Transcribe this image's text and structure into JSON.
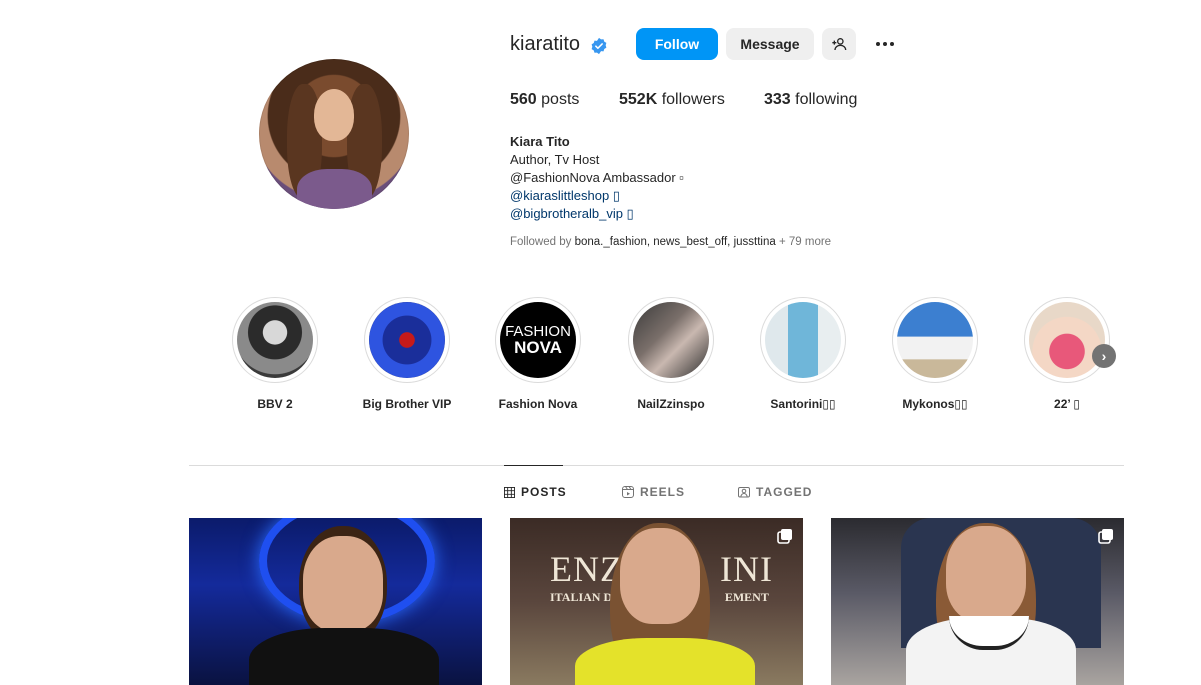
{
  "profile": {
    "username": "kiaratito",
    "verified": true,
    "follow_label": "Follow",
    "message_label": "Message",
    "stats": {
      "posts_count": "560",
      "posts_label": "posts",
      "followers_count": "552K",
      "followers_label": "followers",
      "following_count": "333",
      "following_label": "following"
    },
    "bio": {
      "name": "Kiara Tito",
      "line1": "Author, Tv Host",
      "line2": "@FashionNova Ambassador ▫",
      "link1": "@kiaraslittleshop ▯",
      "link2": "@bigbrotheralb_vip ▯"
    },
    "followed_by": {
      "prefix": "Followed by",
      "names": "bona._fashion, news_best_off, jussttina",
      "more": "+ 79 more"
    }
  },
  "highlights": [
    {
      "label": "BBV 2"
    },
    {
      "label": "Big Brother VIP"
    },
    {
      "label": "Fashion Nova"
    },
    {
      "label": "NailZzinspo"
    },
    {
      "label": "Santorini▯▯"
    },
    {
      "label": "Mykonos▯▯"
    },
    {
      "label": "22’ ▯"
    }
  ],
  "highlight_logo": {
    "top": "FASHION",
    "bottom": "NOVA"
  },
  "tabs": [
    {
      "label": "POSTS",
      "icon": "grid-icon",
      "active": true
    },
    {
      "label": "REELS",
      "icon": "reels-icon",
      "active": false
    },
    {
      "label": "TAGGED",
      "icon": "tagged-icon",
      "active": false
    }
  ],
  "posts": {
    "post2_sign": "ENZO",
    "post2_sign_b": "INI",
    "post2_sub": "ITALIAN DES",
    "post2_sub_b": "EMENT"
  },
  "colors": {
    "accent": "#0095f6",
    "verified": "#3897f0",
    "link": "#00376b",
    "muted": "#737373"
  }
}
